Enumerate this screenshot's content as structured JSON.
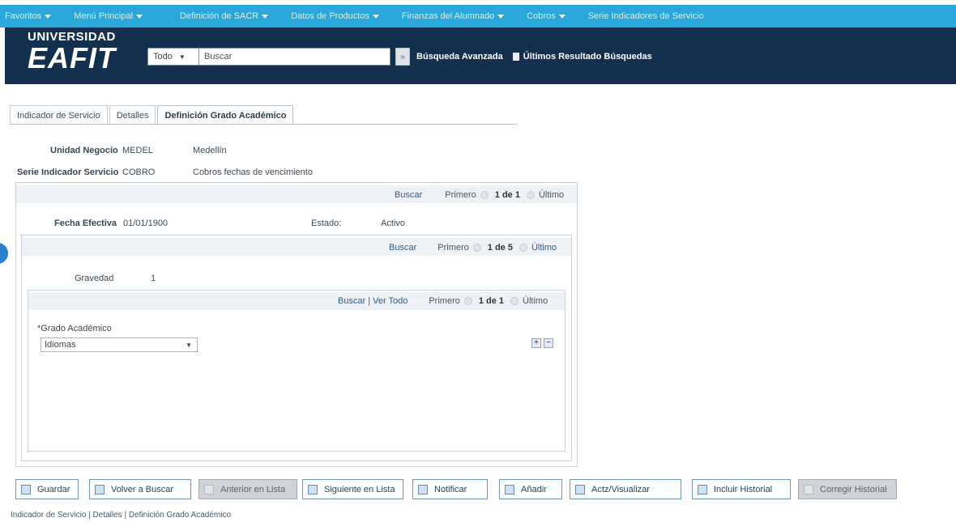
{
  "top_menu": [
    "Favoritos",
    "Menú Principal",
    "Definición de SACR",
    "Datos de Productos",
    "Finanzas del Alumnado",
    "Cobros",
    "Serie Indicadores de Servicio"
  ],
  "logo": {
    "line1": "UNIVERSIDAD",
    "line2": "EAFIT"
  },
  "search": {
    "scope": "Todo",
    "placeholder": "Buscar",
    "advanced": "Búsqueda Avanzada",
    "last": "Últimos Resultado Búsquedas"
  },
  "tabs": [
    "Indicador de Servicio",
    "Detalles",
    "Definición Grado Académico"
  ],
  "fields": {
    "unidad_label": "Unidad Negocio",
    "unidad_code": "MEDEL",
    "unidad_desc": "Medellín",
    "serie_label": "Serie Indicador Servicio",
    "serie_code": "COBRO",
    "serie_desc": "Cobros fechas de vencimiento",
    "fecha_label": "Fecha Efectiva",
    "fecha_value": "01/01/1900",
    "estado_label": "Estado:",
    "estado_value": "Activo",
    "gravedad_label": "Gravedad",
    "gravedad_value": "1",
    "grado_label": "*Grado Académico",
    "grado_value": "Idiomas"
  },
  "nav1": {
    "buscar": "Buscar",
    "primero": "Primero",
    "count": "1 de 1",
    "ultimo": "Último"
  },
  "nav2": {
    "buscar": "Buscar",
    "primero": "Primero",
    "count": "1 de 5",
    "ultimo": "Último"
  },
  "nav3": {
    "buscar": "Buscar",
    "sep": "|",
    "ver_todo": "Ver Todo",
    "primero": "Primero",
    "count": "1 de 1",
    "ultimo": "Último"
  },
  "buttons": [
    "Guardar",
    "Volver a Buscar",
    "Anterior en Lista",
    "Siguiente en Lista",
    "Notificar",
    "Añadir",
    "Actz/Visualizar",
    "Incluir Historial",
    "Corregir Historial"
  ],
  "footer": [
    "Indicador de Servicio",
    "Detalles",
    "Definición Grado Académico"
  ],
  "footer_sep": " | "
}
